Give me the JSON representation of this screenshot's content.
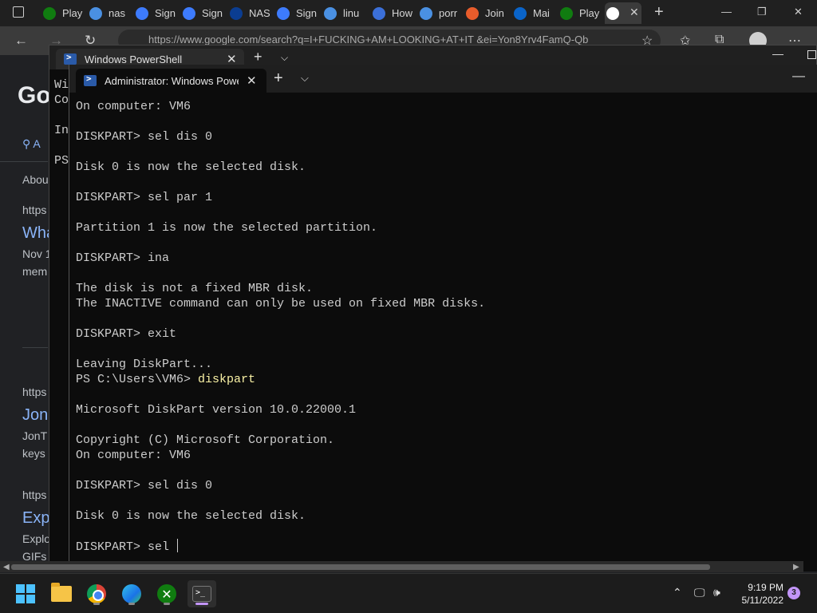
{
  "browser": {
    "tabs": [
      {
        "label": "Play",
        "icon": "xbox-icon",
        "color": "#107c10"
      },
      {
        "label": "nas",
        "icon": "search-icon",
        "color": "#4a90e2"
      },
      {
        "label": "Sign",
        "icon": "signin-icon",
        "color": "#3d7bfd"
      },
      {
        "label": "Sign",
        "icon": "signin-icon",
        "color": "#3d7bfd"
      },
      {
        "label": "NAS",
        "icon": "nasa-icon",
        "color": "#0b3d91"
      },
      {
        "label": "Sign",
        "icon": "signin-icon",
        "color": "#3d7bfd"
      },
      {
        "label": "linu",
        "icon": "search-icon",
        "color": "#4a90e2"
      },
      {
        "label": "How",
        "icon": "howto-icon",
        "color": "#3b6fd8"
      },
      {
        "label": "porr",
        "icon": "search-icon",
        "color": "#4a90e2"
      },
      {
        "label": "Join",
        "icon": "g4g-icon",
        "color": "#e85c2b"
      },
      {
        "label": "Mai",
        "icon": "outlook-icon",
        "color": "#0a64c9"
      },
      {
        "label": "Play",
        "icon": "xbox-icon",
        "color": "#107c10"
      },
      {
        "label": "",
        "icon": "google-icon",
        "color": "#ffffff"
      }
    ],
    "address": "https://www.google.com/search?q=I+FUCKING+AM+LOOKING+AT+IT &ei=Yon8Yrv4FamQ-Qb"
  },
  "google": {
    "logo": "Go",
    "tab_label": "A",
    "about": "Abou",
    "results": [
      {
        "url": "https",
        "title": "Wha",
        "desc1": "Nov 1",
        "desc2": "mem"
      },
      {
        "url": "https",
        "title": "Jon",
        "desc1": "JonT",
        "desc2": "keys"
      },
      {
        "url": "https",
        "title": "Exp",
        "desc1": "Explore a",
        "desc2": "GIFs here"
      }
    ]
  },
  "ps_back": {
    "tab_title": "Windows PowerShell",
    "lines": [
      "Wi",
      "Co",
      "",
      "In",
      "",
      "PS"
    ]
  },
  "terminal": {
    "tab_title": "Administrator: Windows PowerShell",
    "lines": [
      {
        "text": "On computer: VM6"
      },
      {
        "text": ""
      },
      {
        "text": "DISKPART> sel dis 0"
      },
      {
        "text": ""
      },
      {
        "text": "Disk 0 is now the selected disk."
      },
      {
        "text": ""
      },
      {
        "text": "DISKPART> sel par 1"
      },
      {
        "text": ""
      },
      {
        "text": "Partition 1 is now the selected partition."
      },
      {
        "text": ""
      },
      {
        "text": "DISKPART> ina"
      },
      {
        "text": ""
      },
      {
        "text": "The disk is not a fixed MBR disk."
      },
      {
        "text": "The INACTIVE command can only be used on fixed MBR disks."
      },
      {
        "text": ""
      },
      {
        "text": "DISKPART> exit"
      },
      {
        "text": ""
      },
      {
        "text": "Leaving DiskPart..."
      },
      {
        "text": "PS C:\\Users\\VM6> ",
        "cmd": "diskpart"
      },
      {
        "text": ""
      },
      {
        "text": "Microsoft DiskPart version 10.0.22000.1"
      },
      {
        "text": ""
      },
      {
        "text": "Copyright (C) Microsoft Corporation."
      },
      {
        "text": "On computer: VM6"
      },
      {
        "text": ""
      },
      {
        "text": "DISKPART> sel dis 0"
      },
      {
        "text": ""
      },
      {
        "text": "Disk 0 is now the selected disk."
      },
      {
        "text": ""
      },
      {
        "text": "DISKPART> sel ",
        "cursor": true
      }
    ]
  },
  "taskbar": {
    "apps": [
      "start-icon",
      "file-explorer-icon",
      "chrome-icon",
      "edge-icon",
      "xbox-icon",
      "terminal-icon"
    ],
    "time": "9:19 PM",
    "date": "5/11/2022",
    "notifications": "3",
    "accent": "#c295f8"
  }
}
